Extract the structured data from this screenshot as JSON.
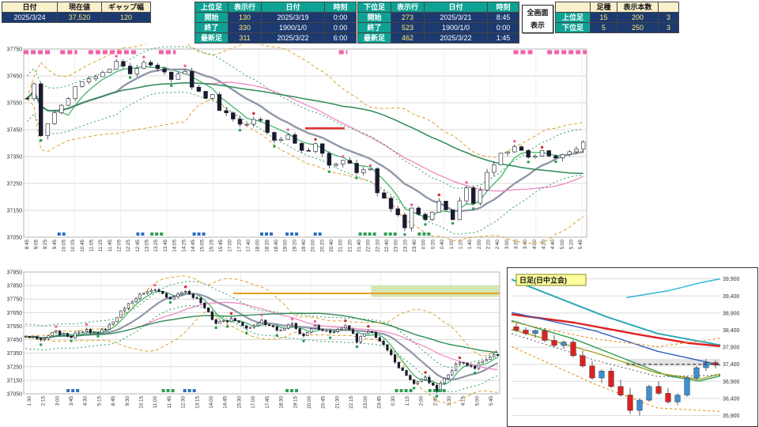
{
  "header": {
    "left": {
      "h": [
        "日付",
        "現在値",
        "ギャップ幅"
      ],
      "v": [
        "2025/3/24",
        "37,520",
        "120"
      ]
    },
    "upper": {
      "c0": "上位足",
      "c1": "表示行",
      "c2": "日付",
      "c3": "時刻",
      "rows": [
        [
          "開始",
          "130",
          "2025/3/19",
          "0:00"
        ],
        [
          "終了",
          "330",
          "1900/1/0",
          "0:00"
        ],
        [
          "最新足",
          "311",
          "2025/3/22",
          "6:00"
        ]
      ]
    },
    "lower": {
      "c0": "下位足",
      "c1": "表示行",
      "c2": "日付",
      "c3": "時刻",
      "rows": [
        [
          "開始",
          "273",
          "2025/3/21",
          "8:45"
        ],
        [
          "終了",
          "523",
          "1900/1/0",
          "0:00"
        ],
        [
          "最新足",
          "462",
          "2025/3/22",
          "1:45"
        ]
      ]
    },
    "fullscreen": {
      "line1": "全画面",
      "line2": "表示"
    },
    "right": {
      "h1": "足種",
      "h2": "表示本数",
      "rows": [
        [
          "上位足",
          "15",
          "200",
          "3"
        ],
        [
          "下位足",
          "5",
          "250",
          "3"
        ]
      ]
    }
  },
  "chart_data": [
    {
      "id": "main",
      "type": "candlestick",
      "timeframe": "15min-intraday",
      "bars": 82,
      "y_min": 37050,
      "y_max": 37750,
      "noise": 11,
      "wick": 14,
      "seed": 11,
      "y_ticks": [
        "37750",
        "37650",
        "37550",
        "37450",
        "37350",
        "37250",
        "37150",
        "37050"
      ],
      "x_labels": [
        "8:45",
        "9:05",
        "9:25",
        "9:45",
        "10:05",
        "10:25",
        "10:45",
        "11:05",
        "11:25",
        "11:45",
        "12:05",
        "12:25",
        "12:45",
        "13:05",
        "13:25",
        "13:45",
        "14:05",
        "14:25",
        "14:45",
        "15:05",
        "15:25",
        "15:45",
        "17:00",
        "17:20",
        "17:40",
        "18:00",
        "18:20",
        "18:40",
        "19:00",
        "19:20",
        "19:40",
        "20:00",
        "20:20",
        "20:40",
        "21:00",
        "21:20",
        "21:40",
        "22:00",
        "22:20",
        "22:40",
        "23:00",
        "23:20",
        "23:40",
        "0:00",
        "0:20",
        "0:40",
        "1:00",
        "1:20",
        "1:40",
        "2:00",
        "2:20",
        "2:40",
        "3:00",
        "3:20",
        "3:40",
        "4:00",
        "4:20",
        "4:40",
        "5:00",
        "5:20",
        "5:45"
      ],
      "close_anchors": [
        [
          0,
          37565
        ],
        [
          1,
          37620
        ],
        [
          2,
          37425
        ],
        [
          3,
          37470
        ],
        [
          5,
          37540
        ],
        [
          7,
          37610
        ],
        [
          9,
          37640
        ],
        [
          11,
          37655
        ],
        [
          13,
          37700
        ],
        [
          15,
          37665
        ],
        [
          17,
          37705
        ],
        [
          19,
          37680
        ],
        [
          21,
          37645
        ],
        [
          23,
          37665
        ],
        [
          24,
          37610
        ],
        [
          26,
          37560
        ],
        [
          27,
          37575
        ],
        [
          28,
          37525
        ],
        [
          30,
          37495
        ],
        [
          32,
          37465
        ],
        [
          34,
          37490
        ],
        [
          36,
          37405
        ],
        [
          38,
          37430
        ],
        [
          40,
          37365
        ],
        [
          42,
          37390
        ],
        [
          44,
          37320
        ],
        [
          46,
          37345
        ],
        [
          48,
          37290
        ],
        [
          50,
          37310
        ],
        [
          51,
          37215
        ],
        [
          53,
          37165
        ],
        [
          55,
          37095
        ],
        [
          56,
          37160
        ],
        [
          58,
          37105
        ],
        [
          60,
          37185
        ],
        [
          62,
          37125
        ],
        [
          64,
          37235
        ],
        [
          65,
          37170
        ],
        [
          67,
          37290
        ],
        [
          69,
          37355
        ],
        [
          71,
          37395
        ],
        [
          73,
          37345
        ],
        [
          75,
          37375
        ],
        [
          77,
          37335
        ],
        [
          79,
          37365
        ],
        [
          81,
          37395
        ]
      ],
      "lines": [
        {
          "type": "sma",
          "period": 5,
          "color": "#35b060",
          "width": 1.2
        },
        {
          "type": "sma",
          "period": 12,
          "color": "#9098a8",
          "width": 2.4
        },
        {
          "type": "sma",
          "period": 26,
          "color": "#f080c0",
          "width": 1.2
        },
        {
          "type": "sma",
          "period": 45,
          "color": "#2e8b57",
          "width": 1.5
        },
        {
          "type": "bollu",
          "period": 22,
          "k": 2,
          "color": "#e0a030",
          "width": 1,
          "dash": "4 3"
        },
        {
          "type": "bolld",
          "period": 22,
          "k": 2,
          "color": "#e0a030",
          "width": 1,
          "dash": "4 3"
        },
        {
          "type": "envu",
          "period": 12,
          "off": 85,
          "color": "#2fa060",
          "width": 1,
          "dash": "2 3"
        },
        {
          "type": "envd",
          "period": 12,
          "off": 85,
          "color": "#2fa060",
          "width": 1,
          "dash": "2 3"
        }
      ],
      "top_dash_zones": [
        [
          0.0,
          0.05
        ],
        [
          0.065,
          0.095
        ],
        [
          0.115,
          0.2
        ],
        [
          0.24,
          0.27
        ],
        [
          0.56,
          0.575
        ],
        [
          0.87,
          0.905
        ],
        [
          0.93,
          1.0
        ]
      ],
      "bottom_squares_blue": [
        [
          0.06,
          0.075
        ],
        [
          0.2,
          0.215
        ],
        [
          0.3,
          0.32
        ],
        [
          0.42,
          0.445
        ],
        [
          0.465,
          0.49
        ],
        [
          0.515,
          0.53
        ]
      ],
      "bottom_squares_green": [
        [
          0.225,
          0.245
        ],
        [
          0.595,
          0.625
        ],
        [
          0.64,
          0.665
        ],
        [
          0.7,
          0.72
        ]
      ],
      "h_segments": [
        {
          "price": 37455,
          "from": 0.5,
          "to": 0.57,
          "color": "#e03030",
          "width": 2.5
        }
      ],
      "bands": []
    },
    {
      "id": "lower",
      "type": "candlestick",
      "timeframe": "5min-intraday",
      "bars": 125,
      "y_min": 37050,
      "y_max": 37950,
      "noise": 13,
      "wick": 16,
      "seed": 23,
      "y_ticks": [
        "37950",
        "37850",
        "37750",
        "37650",
        "37550",
        "37450",
        "37350",
        "37250",
        "37150",
        "37050"
      ],
      "x_labels": [
        "1:30",
        "2:15",
        "3:00",
        "3:45",
        "4:30",
        "5:15",
        "8:45",
        "9:30",
        "10:15",
        "11:00",
        "11:45",
        "12:30",
        "13:15",
        "14:00",
        "14:45",
        "15:30",
        "17:00",
        "17:45",
        "18:30",
        "19:15",
        "20:00",
        "20:45",
        "21:30",
        "22:15",
        "23:00",
        "23:45",
        "0:30",
        "1:15",
        "2:00",
        "2:45",
        "3:30",
        "4:15",
        "5:00",
        "5:45"
      ],
      "close_anchors": [
        [
          0,
          37485
        ],
        [
          4,
          37455
        ],
        [
          8,
          37505
        ],
        [
          12,
          37475
        ],
        [
          16,
          37520
        ],
        [
          19,
          37495
        ],
        [
          22,
          37555
        ],
        [
          26,
          37690
        ],
        [
          30,
          37775
        ],
        [
          34,
          37815
        ],
        [
          38,
          37755
        ],
        [
          42,
          37800
        ],
        [
          46,
          37730
        ],
        [
          50,
          37565
        ],
        [
          54,
          37605
        ],
        [
          58,
          37540
        ],
        [
          62,
          37590
        ],
        [
          66,
          37515
        ],
        [
          70,
          37570
        ],
        [
          73,
          37470
        ],
        [
          76,
          37550
        ],
        [
          80,
          37500
        ],
        [
          84,
          37560
        ],
        [
          87,
          37445
        ],
        [
          90,
          37520
        ],
        [
          93,
          37435
        ],
        [
          96,
          37330
        ],
        [
          99,
          37215
        ],
        [
          102,
          37120
        ],
        [
          105,
          37170
        ],
        [
          108,
          37075
        ],
        [
          111,
          37200
        ],
        [
          114,
          37290
        ],
        [
          118,
          37250
        ],
        [
          121,
          37310
        ],
        [
          124,
          37340
        ]
      ],
      "lines": [
        {
          "type": "sma",
          "period": 5,
          "color": "#35b060",
          "width": 1.2
        },
        {
          "type": "sma",
          "period": 14,
          "color": "#9098a8",
          "width": 2.2
        },
        {
          "type": "sma",
          "period": 30,
          "color": "#f080c0",
          "width": 1.2
        },
        {
          "type": "sma",
          "period": 55,
          "color": "#2e8b57",
          "width": 1.4
        },
        {
          "type": "bollu",
          "period": 24,
          "k": 2,
          "color": "#e0a030",
          "width": 1,
          "dash": "4 3"
        },
        {
          "type": "bolld",
          "period": 24,
          "k": 2,
          "color": "#e0a030",
          "width": 1,
          "dash": "4 3"
        },
        {
          "type": "envu",
          "period": 14,
          "off": 90,
          "color": "#2fa060",
          "width": 1,
          "dash": "2 3"
        },
        {
          "type": "envd",
          "period": 14,
          "off": 90,
          "color": "#2fa060",
          "width": 1,
          "dash": "2 3"
        }
      ],
      "top_dash_zones": [],
      "bottom_squares_blue": [
        [
          0.09,
          0.11
        ],
        [
          0.335,
          0.355
        ]
      ],
      "bottom_squares_green": [
        [
          0.29,
          0.31
        ],
        [
          0.55,
          0.57
        ],
        [
          0.78,
          0.81
        ],
        [
          0.85,
          0.88
        ]
      ],
      "h_segments": [
        {
          "price": 37792,
          "from": 0.44,
          "to": 1,
          "color": "#e8a020",
          "width": 2
        }
      ],
      "bands": [
        {
          "from": 0.73,
          "to": 1,
          "top": 37850,
          "bottom": 37765,
          "color": "#cfe3a8",
          "opacity": 0.9
        }
      ]
    },
    {
      "id": "daily",
      "type": "candlestick",
      "timeframe": "daily",
      "title": "日足(日中立会)",
      "y_min": 35750,
      "y_max": 40100,
      "y_ticks": [
        "39,900",
        "39,400",
        "38,900",
        "38,400",
        "37,900",
        "37,400",
        "36,900",
        "36,400",
        "35,900"
      ],
      "candles": [
        [
          38500,
          38600,
          38350,
          38400,
          "r"
        ],
        [
          38400,
          38480,
          38250,
          38300,
          "r"
        ],
        [
          38300,
          38420,
          38180,
          38380,
          "b"
        ],
        [
          38380,
          38450,
          38050,
          38100,
          "r"
        ],
        [
          38100,
          38250,
          37900,
          37950,
          "r"
        ],
        [
          37950,
          38100,
          37850,
          38050,
          "b"
        ],
        [
          38050,
          38120,
          37600,
          37650,
          "r"
        ],
        [
          37650,
          37800,
          37300,
          37350,
          "r"
        ],
        [
          37350,
          37500,
          36950,
          37000,
          "r"
        ],
        [
          37000,
          37250,
          36850,
          37200,
          "b"
        ],
        [
          37200,
          37300,
          36700,
          36750,
          "r"
        ],
        [
          36750,
          36950,
          36450,
          36500,
          "r"
        ],
        [
          36500,
          36700,
          35950,
          36050,
          "r"
        ],
        [
          36050,
          36400,
          35900,
          36350,
          "b"
        ],
        [
          36350,
          36800,
          36300,
          36750,
          "b"
        ],
        [
          36750,
          36900,
          36500,
          36550,
          "r"
        ],
        [
          36550,
          36700,
          36250,
          36300,
          "r"
        ],
        [
          36300,
          36550,
          36200,
          36500,
          "b"
        ],
        [
          36500,
          37050,
          36450,
          37000,
          "b"
        ],
        [
          37000,
          37350,
          36950,
          37300,
          "b"
        ],
        [
          37300,
          37550,
          37200,
          37450,
          "b"
        ],
        [
          37450,
          37520,
          37280,
          37380,
          "r"
        ]
      ],
      "lines": [
        {
          "name": "teal-ma",
          "color": "#2aa8b8",
          "width": 2,
          "dash": "",
          "points": [
            [
              0,
              39880
            ],
            [
              0.2,
              39400
            ],
            [
              0.45,
              38800
            ],
            [
              0.7,
              38300
            ],
            [
              1,
              37960
            ]
          ]
        },
        {
          "name": "cyan-upper",
          "color": "#30b8d8",
          "width": 1.5,
          "dash": "",
          "points": [
            [
              0.55,
              39350
            ],
            [
              0.75,
              39550
            ],
            [
              0.9,
              39780
            ],
            [
              1,
              39900
            ]
          ]
        },
        {
          "name": "red-ma",
          "color": "#e02020",
          "width": 2.4,
          "dash": "",
          "points": [
            [
              0,
              38860
            ],
            [
              0.3,
              38620
            ],
            [
              0.6,
              38280
            ],
            [
              0.85,
              38020
            ],
            [
              1,
              37930
            ]
          ]
        },
        {
          "name": "blue-ma",
          "color": "#3060c0",
          "width": 1.4,
          "dash": "",
          "points": [
            [
              0,
              38920
            ],
            [
              0.4,
              38380
            ],
            [
              0.7,
              37780
            ],
            [
              1,
              37380
            ]
          ]
        },
        {
          "name": "green-ma",
          "color": "#2f9e50",
          "width": 1.4,
          "dash": "",
          "points": [
            [
              0,
              38680
            ],
            [
              0.3,
              38140
            ],
            [
              0.55,
              37540
            ],
            [
              0.75,
              37060
            ],
            [
              0.9,
              36910
            ],
            [
              1,
              37060
            ]
          ]
        },
        {
          "name": "olive-ma",
          "color": "#a0a020",
          "width": 1.4,
          "dash": "",
          "points": [
            [
              0,
              38420
            ],
            [
              0.4,
              37740
            ],
            [
              0.7,
              37140
            ],
            [
              0.9,
              36960
            ],
            [
              1,
              37120
            ]
          ]
        },
        {
          "name": "boll-upper",
          "color": "#e8982f",
          "width": 1.2,
          "dash": "3 3",
          "points": [
            [
              0,
              38640
            ],
            [
              0.4,
              38140
            ],
            [
              0.7,
              37920
            ],
            [
              1,
              38160
            ]
          ]
        },
        {
          "name": "boll-lower",
          "color": "#e8982f",
          "width": 1.2,
          "dash": "3 3",
          "points": [
            [
              0,
              37920
            ],
            [
              0.4,
              36820
            ],
            [
              0.7,
              36120
            ],
            [
              1,
              36020
            ]
          ]
        },
        {
          "name": "mid-dotted",
          "color": "#555555",
          "width": 1,
          "dash": "2 3",
          "points": [
            [
              0,
              38300
            ],
            [
              0.4,
              37520
            ],
            [
              0.7,
              37040
            ],
            [
              1,
              37080
            ]
          ]
        }
      ],
      "band": {
        "from": 0.55,
        "to": 1,
        "top": 37560,
        "bottom": 37340,
        "color": "#d8d8d8",
        "opacity": 0.7
      },
      "current_price_line": {
        "price": 37400,
        "from": 0.55,
        "to": 1
      }
    }
  ]
}
